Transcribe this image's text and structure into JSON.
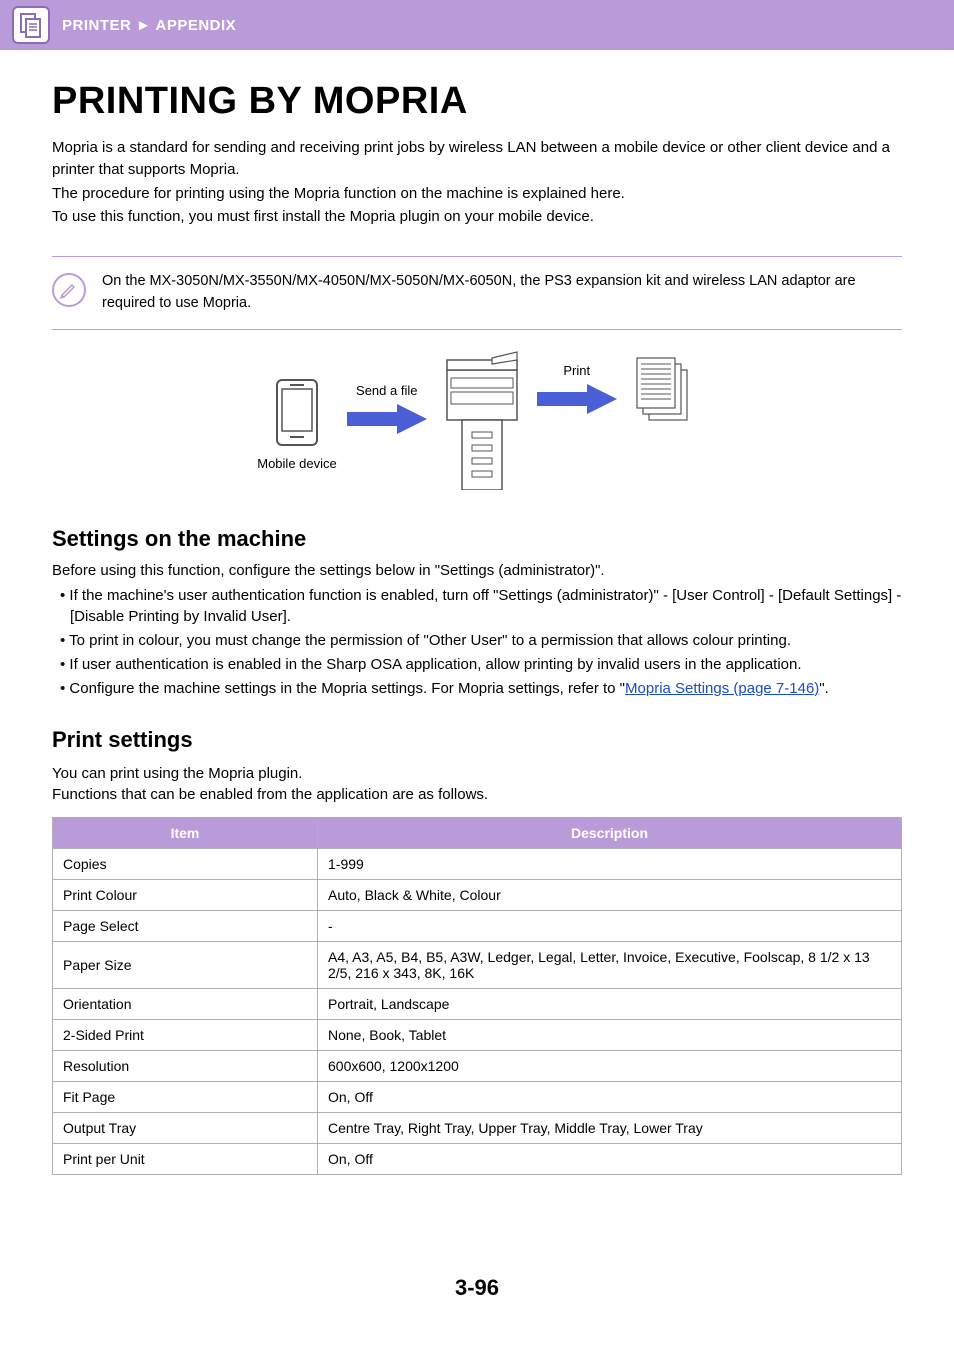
{
  "header": {
    "breadcrumb_section": "PRINTER",
    "breadcrumb_separator": "►",
    "breadcrumb_page": "APPENDIX"
  },
  "title": "PRINTING BY MOPRIA",
  "intro": {
    "p1": "Mopria is a standard for sending and receiving print jobs by wireless LAN between a mobile device or other client device and a printer that supports Mopria.",
    "p2": "The procedure for printing using the Mopria function on the machine is explained here.",
    "p3": "To use this function, you must first install the Mopria plugin on your mobile device."
  },
  "note": "On the MX-3050N/MX-3550N/MX-4050N/MX-5050N/MX-6050N, the PS3 expansion kit and wireless LAN adaptor are required to use Mopria.",
  "diagram": {
    "mobile_label": "Mobile device",
    "arrow1": "Send a file",
    "arrow2": "Print"
  },
  "settings_machine": {
    "heading": "Settings on the machine",
    "intro": "Before using this function, configure the settings below in \"Settings (administrator)\".",
    "bullets": [
      "If the machine's user authentication function is enabled, turn off \"Settings (administrator)\" - [User Control] - [Default Settings] - [Disable Printing by Invalid User].",
      "To print in colour, you must change the permission of \"Other User\" to a permission that allows colour printing.",
      "If user authentication is enabled in the Sharp OSA application, allow printing by invalid users in the application."
    ],
    "bullet4_prefix": "Configure the machine settings in the Mopria settings. For Mopria settings, refer to \"",
    "bullet4_link": "Mopria Settings (page 7-146)",
    "bullet4_suffix": "\"."
  },
  "print_settings": {
    "heading": "Print settings",
    "intro1": "You can print using the Mopria plugin.",
    "intro2": "Functions that can be enabled from the application are as follows.",
    "columns": {
      "item": "Item",
      "description": "Description"
    },
    "rows": [
      {
        "item": "Copies",
        "desc": "1-999"
      },
      {
        "item": "Print Colour",
        "desc": "Auto, Black & White, Colour"
      },
      {
        "item": "Page Select",
        "desc": "-"
      },
      {
        "item": "Paper Size",
        "desc": "A4, A3, A5, B4, B5, A3W, Ledger, Legal, Letter, Invoice, Executive, Foolscap, 8 1/2 x 13 2/5, 216 x 343, 8K, 16K"
      },
      {
        "item": "Orientation",
        "desc": "Portrait, Landscape"
      },
      {
        "item": "2-Sided Print",
        "desc": "None, Book, Tablet"
      },
      {
        "item": "Resolution",
        "desc": "600x600, 1200x1200"
      },
      {
        "item": "Fit Page",
        "desc": "On, Off"
      },
      {
        "item": "Output Tray",
        "desc": "Centre Tray, Right Tray, Upper Tray, Middle Tray, Lower Tray"
      },
      {
        "item": "Print per Unit",
        "desc": "On, Off"
      }
    ]
  },
  "page_number": "3-96"
}
